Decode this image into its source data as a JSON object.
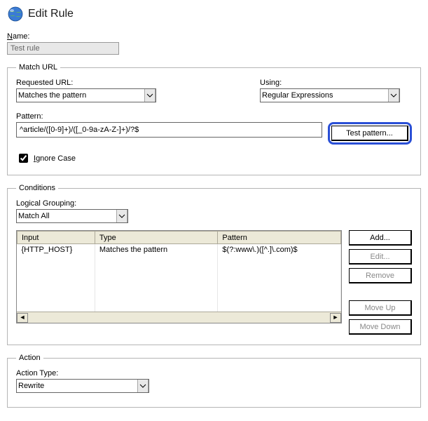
{
  "header": {
    "title": "Edit Rule"
  },
  "name": {
    "label": "Name:",
    "label_key": "N",
    "value": "Test rule"
  },
  "match_url": {
    "legend": "Match URL",
    "requested_label": "Requested URL:",
    "requested_value": "Matches the pattern",
    "using_label": "Using:",
    "using_value": "Regular Expressions",
    "pattern_label": "Pattern:",
    "pattern_value": "^article/([0-9]+)/([_0-9a-zA-Z-]+)/?$",
    "test_button": "Test pattern...",
    "ignore_case_label": "Ignore Case",
    "ignore_case_key": "I",
    "ignore_case_checked": true
  },
  "conditions": {
    "legend": "Conditions",
    "grouping_label": "Logical Grouping:",
    "grouping_value": "Match All",
    "columns": {
      "input": "Input",
      "type": "Type",
      "pattern": "Pattern"
    },
    "rows": [
      {
        "input": "{HTTP_HOST}",
        "type": "Matches the pattern",
        "pattern": "$(?:www\\.)([^.]\\.com)$"
      }
    ],
    "buttons": {
      "add": "Add...",
      "edit": "Edit...",
      "remove": "Remove",
      "move_up": "Move Up",
      "move_down": "Move Down"
    }
  },
  "action": {
    "legend": "Action",
    "type_label": "Action Type:",
    "type_value": "Rewrite"
  }
}
